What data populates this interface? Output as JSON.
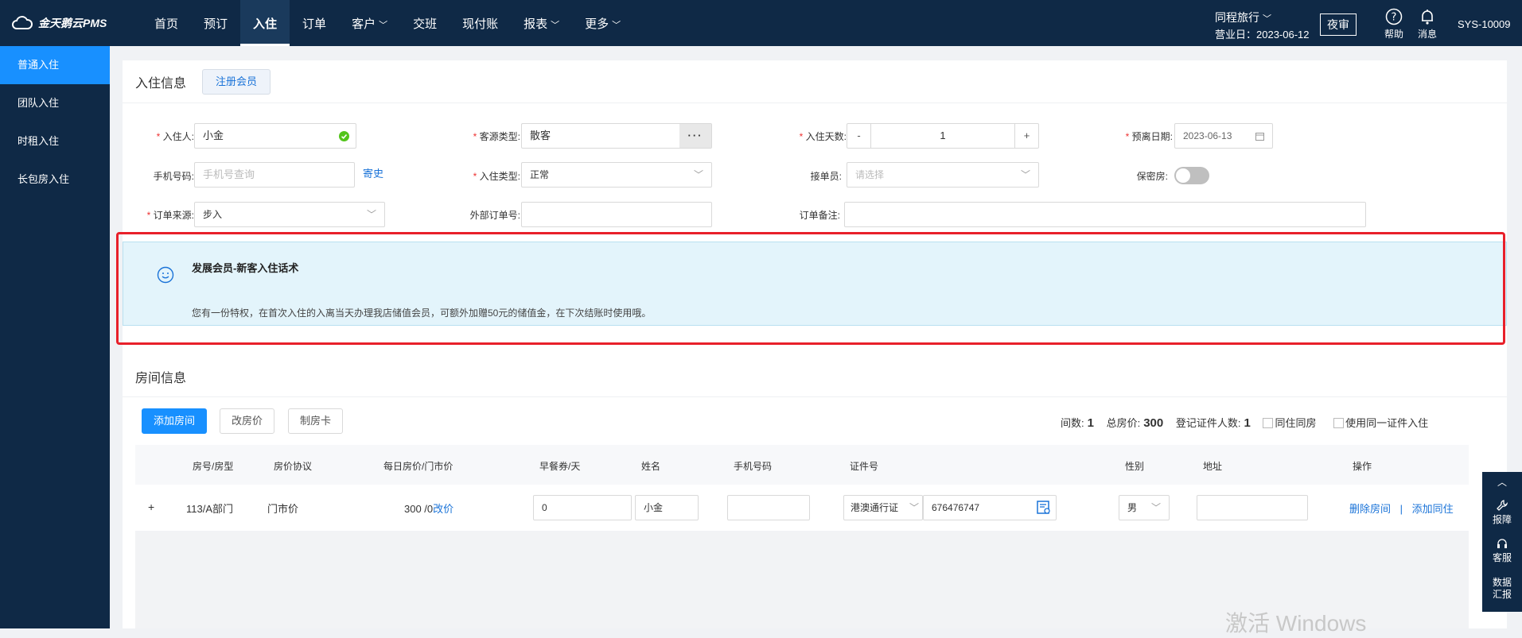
{
  "header": {
    "logo_text": "金天鹅云PMS",
    "nav": [
      {
        "label": "首页"
      },
      {
        "label": "预订"
      },
      {
        "label": "入住"
      },
      {
        "label": "订单"
      },
      {
        "label": "客户"
      },
      {
        "label": "交班"
      },
      {
        "label": "现付账"
      },
      {
        "label": "报表"
      },
      {
        "label": "更多"
      }
    ],
    "hotel_name": "同程旅行",
    "business_date": "营业日：2023-06-12",
    "night_audit": "夜审",
    "help": "帮助",
    "messages": "消息",
    "user_id": "SYS-10009"
  },
  "sidebar": {
    "items": [
      {
        "label": "普通入住"
      },
      {
        "label": "团队入住"
      },
      {
        "label": "时租入住"
      },
      {
        "label": "长包房入住"
      }
    ]
  },
  "checkin": {
    "section_title": "入住信息",
    "register_member": "注册会员",
    "guest_label": "入住人:",
    "guest_value": "小金",
    "source_type_label": "客源类型:",
    "source_type_value": "散客",
    "days_label": "入住天数:",
    "days_minus": "-",
    "days_value": "1",
    "days_plus": "+",
    "departure_label": "预离日期:",
    "departure_value": "2023-06-13",
    "phone_label": "手机号码:",
    "phone_placeholder": "手机号查询",
    "deposit_link": "寄史",
    "checkin_type_label": "入住类型:",
    "checkin_type_value": "正常",
    "receptionist_label": "接单员:",
    "receptionist_placeholder": "请选择",
    "private_room_label": "保密房:",
    "order_source_label": "订单来源:",
    "order_source_value": "步入",
    "external_order_label": "外部订单号:",
    "order_remark_label": "订单备注:"
  },
  "notice": {
    "title": "发展会员-新客入住话术",
    "text": "您有一份特权，在首次入住的入离当天办理我店储值会员，可额外加赠50元的储值金，在下次结账时使用哦。"
  },
  "room": {
    "section_title": "房间信息",
    "add_room": "添加房间",
    "change_price": "改房价",
    "make_card": "制房卡",
    "stats": {
      "rooms_label": "间数:",
      "rooms_value": "1",
      "total_label": "总房价:",
      "total_value": "300",
      "ids_label": "登记证件人数:",
      "ids_value": "1",
      "same_room": "同住同房",
      "same_id": "使用同一证件入住"
    },
    "columns": [
      "房号/房型",
      "房价协议",
      "每日房价/门市价",
      "早餐券/天",
      "姓名",
      "手机号码",
      "证件号",
      "性别",
      "地址",
      "操作"
    ],
    "row": {
      "expand": "+",
      "room": "113/A部门",
      "agreement": "门市价",
      "price": "300 /0",
      "change_price": "改价",
      "breakfast": "0",
      "name": "小金",
      "phone": "",
      "id_type": "港澳通行证",
      "id_number": "676476747",
      "gender": "男",
      "address": "",
      "delete": "删除房间",
      "separator": "|",
      "add_cohabitant": "添加同住"
    }
  },
  "float_tools": [
    {
      "label": "报障"
    },
    {
      "label": "客服"
    },
    {
      "label": "数据汇报"
    }
  ],
  "watermark": "激活 Windows"
}
